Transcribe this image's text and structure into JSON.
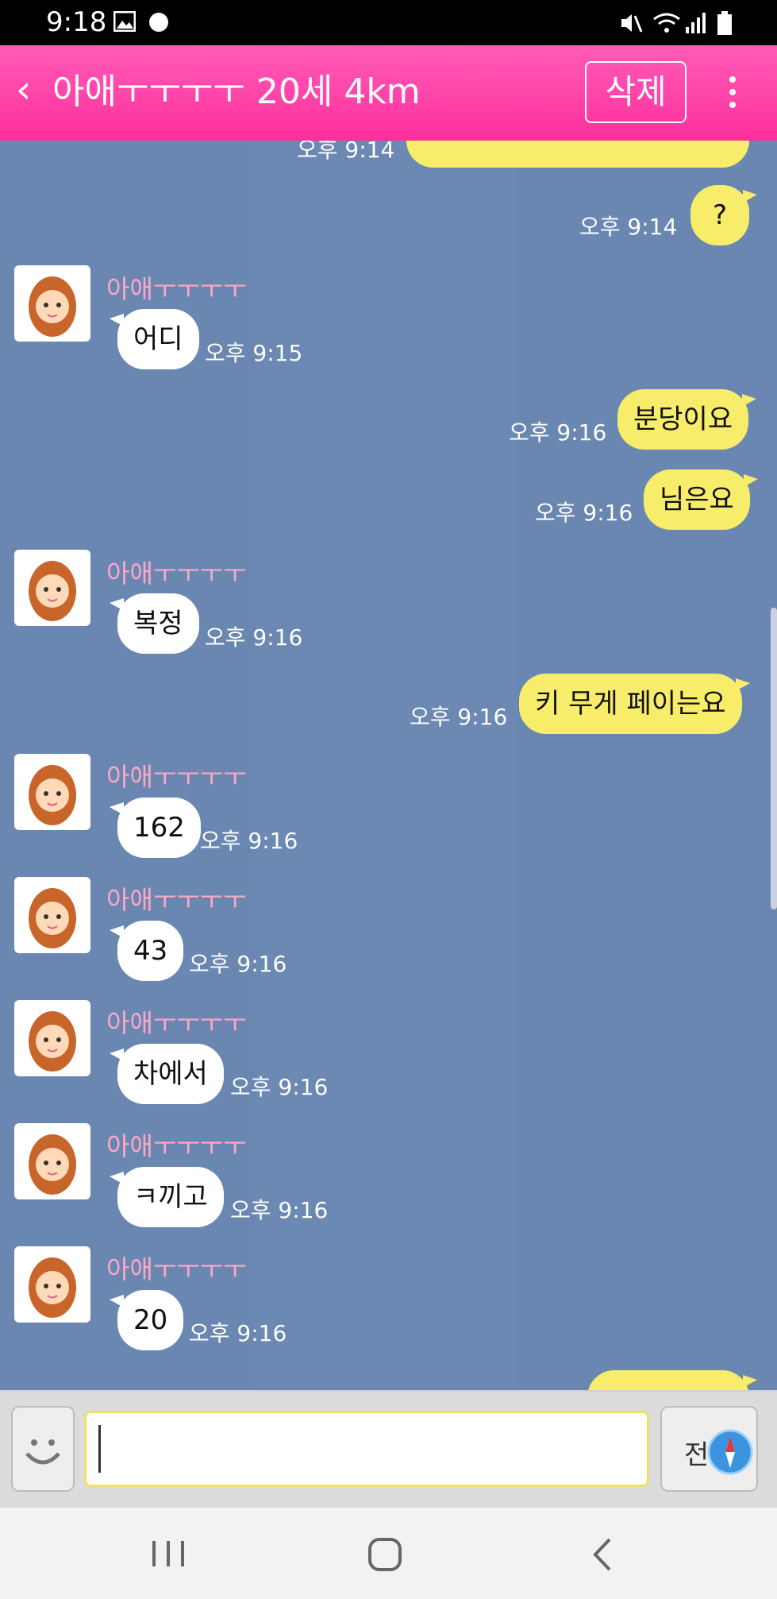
{
  "status_bar": {
    "time": "9:18"
  },
  "header": {
    "back_icon": "chevron-left-icon",
    "title": "아애ㅜㅜㅜㅜ 20세 4km",
    "delete_label": "삭제",
    "menu_icon": "more-vert-icon"
  },
  "chat": {
    "partial_top": {
      "text": "...",
      "time": "오후 9:14"
    },
    "messages": [
      {
        "side": "mine",
        "text": "?",
        "time": "오후 9:14"
      },
      {
        "side": "theirs",
        "name": "아애ㅜㅜㅜㅜ",
        "text": "어디",
        "time": "오후 9:15"
      },
      {
        "side": "mine",
        "text": "분당이요",
        "time": "오후 9:16"
      },
      {
        "side": "mine",
        "text": "님은요",
        "time": "오후 9:16"
      },
      {
        "side": "theirs",
        "name": "아애ㅜㅜㅜㅜ",
        "text": "복정",
        "time": "오후 9:16"
      },
      {
        "side": "mine",
        "text": "키  무게 페이는요",
        "time": "오후 9:16"
      },
      {
        "side": "theirs",
        "name": "아애ㅜㅜㅜㅜ",
        "text": "162",
        "time": "오후 9:16"
      },
      {
        "side": "theirs",
        "name": "아애ㅜㅜㅜㅜ",
        "text": "43",
        "time": "오후 9:16"
      },
      {
        "side": "theirs",
        "name": "아애ㅜㅜㅜㅜ",
        "text": "차에서",
        "time": "오후 9:16"
      },
      {
        "side": "theirs",
        "name": "아애ㅜㅜㅜㅜ",
        "text": "ㅋ끼고",
        "time": "오후 9:16"
      },
      {
        "side": "theirs",
        "name": "아애ㅜㅜㅜㅜ",
        "text": "20",
        "time": "오후 9:16"
      }
    ]
  },
  "input": {
    "value": "",
    "placeholder": "",
    "emoji_icon": "smiley-face-icon",
    "send_label": "전",
    "send_icon": "compass-icon"
  },
  "nav": {
    "recents_icon": "recent-apps-icon",
    "home_icon": "home-icon",
    "back_icon": "back-icon"
  },
  "colors": {
    "header": "#ff2f9d",
    "chat_bg": "#6a87b1",
    "my_bubble": "#f8ec6b",
    "their_bubble": "#ffffff",
    "name_text": "#ffa7c6"
  }
}
